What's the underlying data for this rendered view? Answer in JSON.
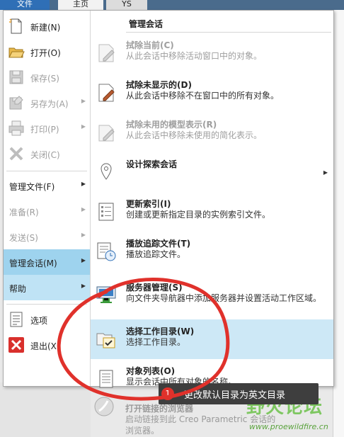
{
  "tabs": [
    "文件",
    "主页",
    "YS"
  ],
  "left_menu": {
    "items": [
      {
        "label": "新建(N)",
        "icon": "new-document-icon",
        "disabled": false
      },
      {
        "label": "打开(O)",
        "icon": "folder-open-icon",
        "disabled": false
      },
      {
        "label": "保存(S)",
        "icon": "save-icon",
        "disabled": true
      },
      {
        "label": "另存为(A)",
        "icon": "save-as-icon",
        "disabled": true
      },
      {
        "label": "打印(P)",
        "icon": "print-icon",
        "disabled": true
      },
      {
        "label": "关闭(C)",
        "icon": "close-icon",
        "disabled": true
      }
    ],
    "sections": [
      {
        "label": "管理文件(F)",
        "disabled": false
      },
      {
        "label": "准备(R)",
        "disabled": true
      },
      {
        "label": "发送(S)",
        "disabled": true
      },
      {
        "label": "管理会话(M)",
        "disabled": false,
        "state": "active"
      },
      {
        "label": "帮助",
        "disabled": false,
        "state": "hover"
      }
    ],
    "bottom": [
      {
        "label": "选项",
        "icon": "options-icon"
      },
      {
        "label": "退出(X)",
        "icon": "exit-icon"
      }
    ]
  },
  "right_pane": {
    "header": "管理会话",
    "items": [
      {
        "title": "拭除当前(C)",
        "desc": "从此会话中移除活动窗口中的对象。",
        "icon": "erase-current-icon",
        "disabled": true
      },
      {
        "title": "拭除未显示的(D)",
        "desc": "从此会话中移除不在窗口中的所有对象。",
        "icon": "erase-not-displayed-icon",
        "disabled": false
      },
      {
        "title": "拭除未用的模型表示(R)",
        "desc": "从此会话中移除未使用的简化表示。",
        "icon": "erase-unused-reps-icon",
        "disabled": true
      },
      {
        "title": "设计探索会话",
        "desc": "",
        "icon": "design-exploration-icon",
        "disabled": false
      },
      {
        "title": "更新索引(I)",
        "desc": "创建或更新指定目录的实例索引文件。",
        "icon": "update-index-icon",
        "disabled": false
      },
      {
        "title": "播放追踪文件(T)",
        "desc": "播放追踪文件。",
        "icon": "play-trail-icon",
        "disabled": false
      },
      {
        "title": "服务器管理(S)",
        "desc": "向文件夹导航器中添加服务器并设置活动工作区域。",
        "icon": "server-management-icon",
        "disabled": false
      },
      {
        "title": "选择工作目录(W)",
        "desc": "选择工作目录。",
        "icon": "select-working-dir-icon",
        "disabled": false,
        "selected": true
      },
      {
        "title": "对象列表(O)",
        "desc": "显示会话中所有对象的名称。",
        "icon": "object-list-icon",
        "disabled": false
      }
    ],
    "below": {
      "title": "打开链接的浏览器",
      "desc": "启动链接到此 Creo Parametric 会话的浏览器。",
      "icon": "linked-browser-icon"
    }
  },
  "tooltip": {
    "number": "1",
    "text": "更改默认目录为英文目录"
  },
  "watermark": {
    "title": "野火论坛",
    "url": "www.proewildfire.cn"
  },
  "colors": {
    "active": "#9ed3ee",
    "selected": "#cde8f6",
    "annotation": "#e0312b",
    "watermark": "#6cc24a"
  }
}
